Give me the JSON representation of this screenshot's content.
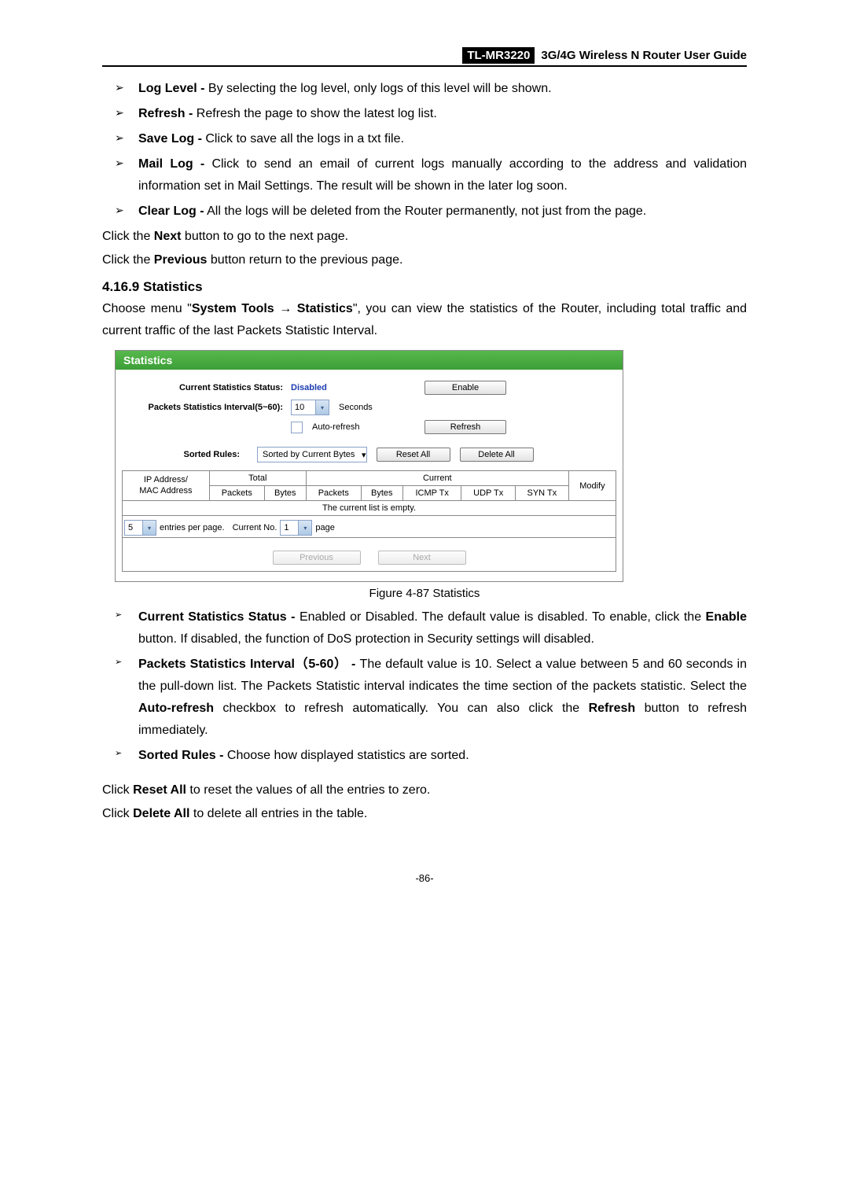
{
  "header": {
    "model": "TL-MR3220",
    "guide": "3G/4G Wireless N Router User Guide"
  },
  "top_list": [
    {
      "term": "Log Level -",
      "desc": " By selecting the log level, only logs of this level will be shown."
    },
    {
      "term": "Refresh -",
      "desc": " Refresh the page to show the latest log list."
    },
    {
      "term": "Save Log -",
      "desc": " Click to save all the logs in a txt file."
    },
    {
      "term": "Mail Log -",
      "desc": " Click to send an email of current logs manually according to the address and validation information set in Mail Settings. The result will be shown in the later log soon."
    },
    {
      "term": "Clear Log -",
      "desc": " All the logs will be deleted from the Router permanently, not just from the page."
    }
  ],
  "nextprev": {
    "p1a": "Click the ",
    "p1b": "Next",
    "p1c": " button to go to the next page.",
    "p2a": "Click the ",
    "p2b": "Previous",
    "p2c": " button return to the previous page."
  },
  "section_heading": "4.16.9  Statistics",
  "section_intro": {
    "a": "Choose menu \"",
    "b": "System Tools",
    "arrow": " → ",
    "c": "Statistics",
    "d": "\", you can view the statistics of the Router, including total traffic and current traffic of the last Packets Statistic Interval."
  },
  "stats_panel": {
    "title": "Statistics",
    "row_status_label": "Current Statistics Status:",
    "row_status_value": "Disabled",
    "btn_enable": "Enable",
    "row_interval_label": "Packets Statistics Interval(5~60):",
    "interval_value": "10",
    "seconds": "Seconds",
    "auto_refresh": "Auto-refresh",
    "btn_refresh": "Refresh",
    "sorted_rules_label": "Sorted Rules:",
    "sorted_value": "Sorted by Current Bytes",
    "btn_reset_all": "Reset All",
    "btn_delete_all": "Delete All",
    "table": {
      "col_ipmac": "IP Address/\nMAC Address",
      "total": "Total",
      "current": "Current",
      "packets": "Packets",
      "bytes": "Bytes",
      "icmptx": "ICMP Tx",
      "udptx": "UDP Tx",
      "syntx": "SYN Tx",
      "modify": "Modify",
      "empty": "The current list is empty."
    },
    "paginate": {
      "entries_val": "5",
      "entries_text": "entries per page.",
      "current_no": "Current No.",
      "page_val": "1",
      "page_text": "page"
    },
    "nav": {
      "previous": "Previous",
      "next": "Next"
    }
  },
  "figure_caption": "Figure 4-87   Statistics",
  "desc_list": [
    {
      "term": "Current Statistics Status -",
      "desc_a": " Enabled or Disabled. The default value is disabled. To enable, click the ",
      "desc_bold": "Enable",
      "desc_b": " button. If disabled, the function of DoS protection in Security settings will disabled."
    },
    {
      "term": "Packets Statistics Interval",
      "term2": "（5-60） -",
      "desc_a": " The default value is 10. Select a value between 5 and 60 seconds in the pull-down list. The Packets Statistic interval indicates the time section of the packets statistic. Select the ",
      "desc_bold": "Auto-refresh",
      "desc_b": " checkbox to refresh automatically. You can also click the ",
      "desc_bold2": "Refresh",
      "desc_c": " button to refresh immediately."
    },
    {
      "term": "Sorted Rules -",
      "desc_a": " Choose how displayed statistics are sorted."
    }
  ],
  "reset_delete": {
    "p1a": "Click ",
    "p1b": "Reset All",
    "p1c": " to reset the values of all the entries to zero.",
    "p2a": "Click ",
    "p2b": "Delete All",
    "p2c": " to delete all entries in the table."
  },
  "page_no": "-86-"
}
